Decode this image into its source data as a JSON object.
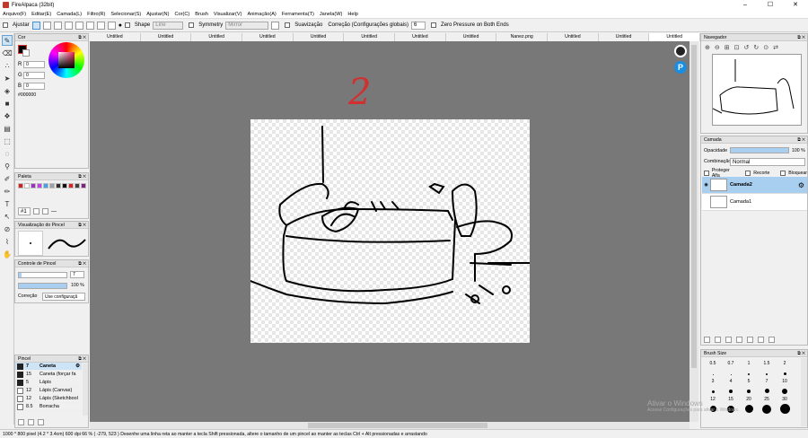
{
  "title": "FireAlpaca (32bit)",
  "window_buttons": [
    "–",
    "☐",
    "✕"
  ],
  "menu": [
    "Arquivo(F)",
    "Editar(E)",
    "Camada(L)",
    "Filtro(R)",
    "Selecionar(S)",
    "Ajustar(N)",
    "Cor(C)",
    "Brush",
    "Visualizar(V)",
    "Animação(A)",
    "Ferramenta(T)",
    "Janela(W)",
    "Help"
  ],
  "toolbar": {
    "ajustar": "Ajustar",
    "shape": "Shape",
    "shape_value": "Line",
    "symmetry": "Symmetry",
    "symmetry_value": "Mirror",
    "suavizacao": "Suavização",
    "correcao": "Correção (Configurações globais)",
    "correcao_value": "6",
    "zero_pressure": "Zero Pressure on Both Ends"
  },
  "tabs": [
    "Untitled",
    "Untitled",
    "Untitled",
    "Untitled",
    "Untitled",
    "Untitled",
    "Untitled",
    "Untitled",
    "Nanez.png",
    "Untitled",
    "Untitled",
    "Untitled"
  ],
  "active_tab": 11,
  "color_panel": {
    "title": "Cor",
    "r_label": "R",
    "r_value": "0",
    "g_label": "G",
    "g_value": "0",
    "b_label": "B",
    "b_value": "0",
    "hex": "#000000"
  },
  "palette_panel": {
    "title": "Paleta",
    "swatches": [
      "#d02020",
      "#ffffff",
      "#9b30c8",
      "#c040e0",
      "#40a0f0",
      "#a0a0a0",
      "#303030",
      "#101010",
      "#e02020",
      "#404040",
      "#802080"
    ],
    "page": "#1"
  },
  "brush_preview": {
    "title": "Visualização do Pincel"
  },
  "brush_control": {
    "title": "Controle de Pincel",
    "size_value": "7",
    "opacity_value": "100 %",
    "correcao_label": "Correção",
    "correcao_value": "Use configuraçã"
  },
  "brush_panel": {
    "title": "Pincel",
    "items": [
      {
        "size": "7",
        "name": "Caneta"
      },
      {
        "size": "15",
        "name": "Caneta (forçar fa"
      },
      {
        "size": "5",
        "name": "Lápis"
      },
      {
        "size": "12",
        "name": "Lápis (Canvas)"
      },
      {
        "size": "12",
        "name": "Lápis (Sketchbool"
      },
      {
        "size": "8.5",
        "name": "Borracha"
      }
    ]
  },
  "navigator": {
    "title": "Navegador"
  },
  "layer_panel": {
    "title": "Camada",
    "opacity_label": "Opacidade",
    "opacity_value": "100 %",
    "blend_label": "Combinação",
    "blend_value": "Normal",
    "protect_alpha": "Proteger Alfa",
    "clipping": "Recorte",
    "lock": "Bloquear",
    "layers": [
      "Camada2",
      "Camada1"
    ]
  },
  "brush_size_panel": {
    "title": "Brush Size",
    "labels_row1": [
      "0.5",
      "0.7",
      "1",
      "1.5",
      "2"
    ],
    "labels_row2": [
      "3",
      "4",
      "5",
      "7",
      "10"
    ],
    "labels_row3": [
      "12",
      "15",
      "20",
      "25",
      "30"
    ]
  },
  "canvas_annotation": "2",
  "status": "1000 * 800 pixel   (4.2 * 3.4cm)   600 dpi   66 %   ( -279, 523 )   Desenhe uma linha reta ao manter a tecla Shift pressionada, altere o tamanho de um pincel ao manter as teclas Ctrl + Alt pressionadas e arrastando",
  "watermark": {
    "line1": "Ativar o Windows",
    "line2": "Acesse Configurações para ativar o Windows."
  },
  "colors": {
    "canvas_bg": "#787878",
    "accent": "#cde4f7",
    "annotation": "#d03030"
  }
}
